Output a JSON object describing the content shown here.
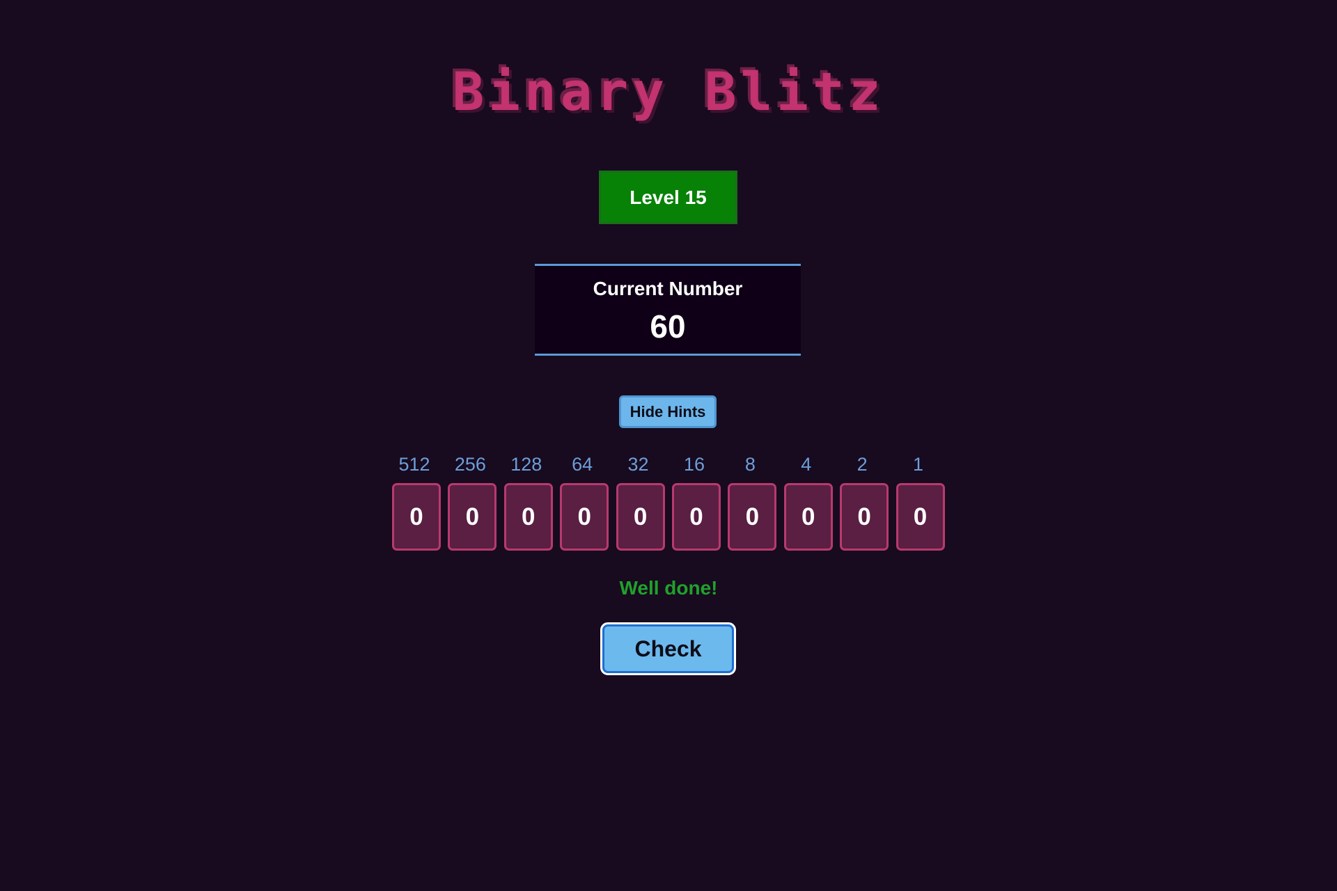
{
  "title": "Binary Blitz",
  "level": {
    "label": "Level 15",
    "value": 15
  },
  "current_number": {
    "label": "Current Number",
    "value": "60"
  },
  "hints_button": {
    "label": "Hide Hints"
  },
  "bits": [
    {
      "hint": "512",
      "value": "0"
    },
    {
      "hint": "256",
      "value": "0"
    },
    {
      "hint": "128",
      "value": "0"
    },
    {
      "hint": "64",
      "value": "0"
    },
    {
      "hint": "32",
      "value": "0"
    },
    {
      "hint": "16",
      "value": "0"
    },
    {
      "hint": "8",
      "value": "0"
    },
    {
      "hint": "4",
      "value": "0"
    },
    {
      "hint": "2",
      "value": "0"
    },
    {
      "hint": "1",
      "value": "0"
    }
  ],
  "feedback": "Well done!",
  "check_button": {
    "label": "Check"
  },
  "colors": {
    "background": "#180a1f",
    "title": "#c2336f",
    "level_badge": "#078207",
    "accent_blue": "#6cb6ec",
    "bit_fill": "#5a1f42",
    "bit_border": "#b83a6e",
    "hint_text": "#6c9fd8",
    "success": "#1fa22a"
  }
}
